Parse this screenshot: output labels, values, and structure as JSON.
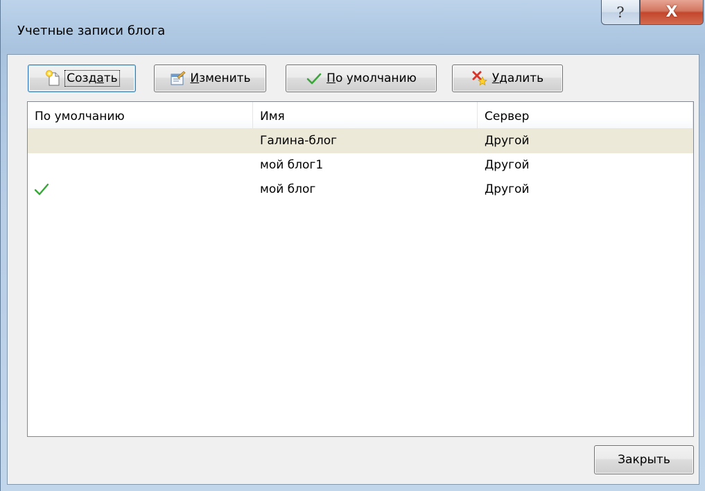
{
  "window": {
    "title": "Учетные записи блога",
    "help_glyph": "?",
    "close_glyph": "X"
  },
  "toolbar": {
    "create": {
      "pre": "Созд",
      "ul": "а",
      "post": "ть",
      "icon": "new-document-icon"
    },
    "edit": {
      "pre": "",
      "ul": "И",
      "post": "зменить",
      "icon": "edit-properties-icon"
    },
    "default": {
      "pre": "",
      "ul": "П",
      "post": "о умолчанию",
      "icon": "green-check-icon"
    },
    "delete": {
      "pre": "",
      "ul": "У",
      "post": "далить",
      "icon": "delete-x-icon"
    }
  },
  "list": {
    "columns": [
      "По умолчанию",
      "Имя",
      "Сервер"
    ],
    "rows": [
      {
        "default": false,
        "name": "Галина-блог",
        "server": "Другой",
        "selected": true
      },
      {
        "default": false,
        "name": "мой блог1",
        "server": "Другой",
        "selected": false
      },
      {
        "default": true,
        "name": "мой блог",
        "server": "Другой",
        "selected": false
      }
    ]
  },
  "footer": {
    "close_label": "Закрыть"
  },
  "colors": {
    "selection": "#ece9d8",
    "check": "#3aa53a",
    "close_red": "#c2472c"
  }
}
